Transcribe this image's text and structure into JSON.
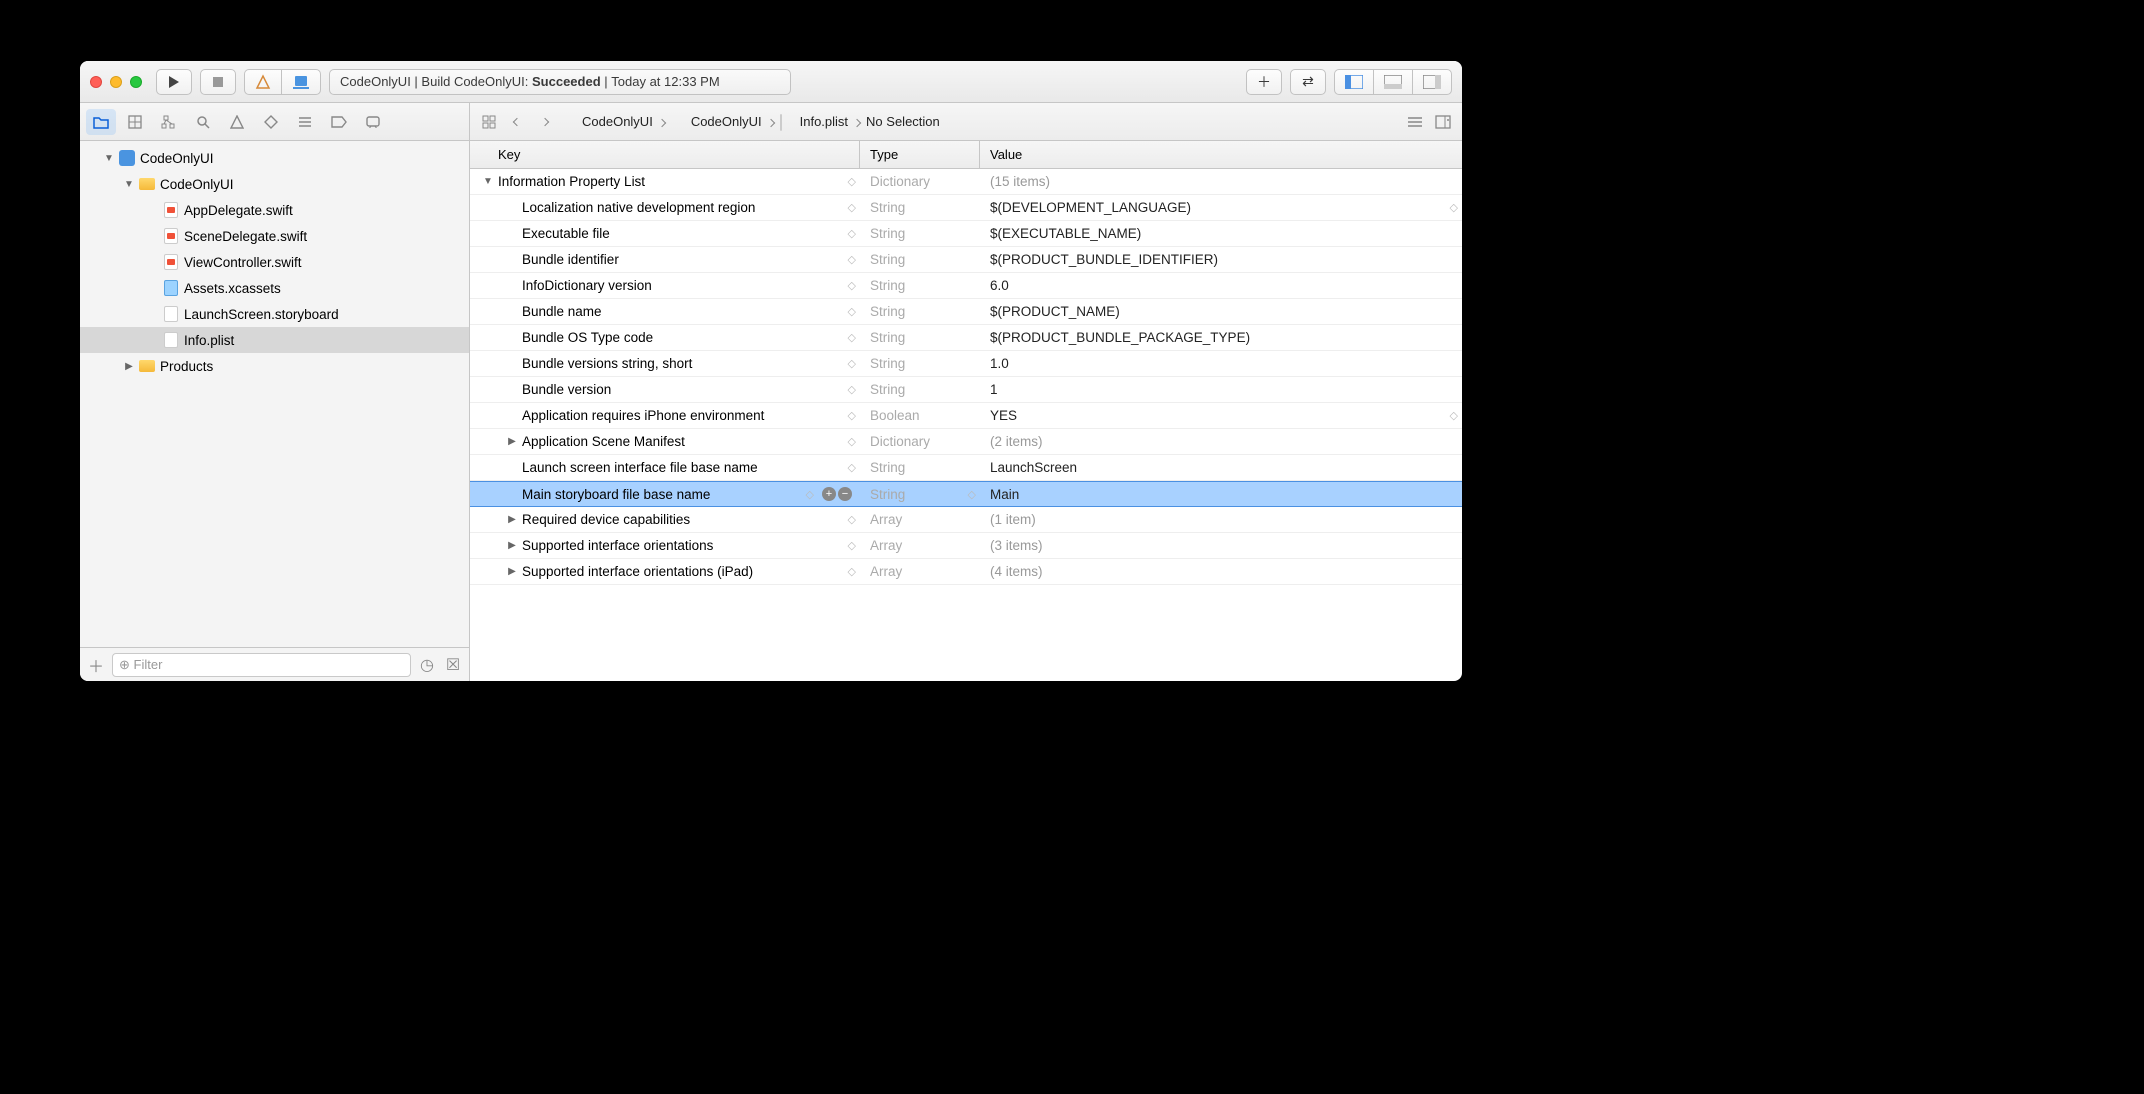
{
  "status": {
    "project": "CodeOnlyUI",
    "build_prefix": "Build CodeOnlyUI:",
    "result": "Succeeded",
    "time": "Today at 12:33 PM"
  },
  "breadcrumb": {
    "items": [
      "CodeOnlyUI",
      "CodeOnlyUI",
      "Info.plist",
      "No Selection"
    ]
  },
  "navigator": {
    "project": "CodeOnlyUI",
    "group": "CodeOnlyUI",
    "files": [
      {
        "name": "AppDelegate.swift",
        "kind": "swift"
      },
      {
        "name": "SceneDelegate.swift",
        "kind": "swift"
      },
      {
        "name": "ViewController.swift",
        "kind": "swift"
      },
      {
        "name": "Assets.xcassets",
        "kind": "asset"
      },
      {
        "name": "LaunchScreen.storyboard",
        "kind": "storyboard"
      },
      {
        "name": "Info.plist",
        "kind": "plist",
        "selected": true
      }
    ],
    "products": "Products"
  },
  "filter_placeholder": "Filter",
  "plist": {
    "columns": {
      "key": "Key",
      "type": "Type",
      "value": "Value"
    },
    "root": {
      "key": "Information Property List",
      "type": "Dictionary",
      "value": "(15 items)"
    },
    "rows": [
      {
        "key": "Localization native development region",
        "type": "String",
        "value": "$(DEVELOPMENT_LANGUAGE)",
        "stepper_right": true
      },
      {
        "key": "Executable file",
        "type": "String",
        "value": "$(EXECUTABLE_NAME)"
      },
      {
        "key": "Bundle identifier",
        "type": "String",
        "value": "$(PRODUCT_BUNDLE_IDENTIFIER)"
      },
      {
        "key": "InfoDictionary version",
        "type": "String",
        "value": "6.0"
      },
      {
        "key": "Bundle name",
        "type": "String",
        "value": "$(PRODUCT_NAME)"
      },
      {
        "key": "Bundle OS Type code",
        "type": "String",
        "value": "$(PRODUCT_BUNDLE_PACKAGE_TYPE)"
      },
      {
        "key": "Bundle versions string, short",
        "type": "String",
        "value": "1.0"
      },
      {
        "key": "Bundle version",
        "type": "String",
        "value": "1"
      },
      {
        "key": "Application requires iPhone environment",
        "type": "Boolean",
        "value": "YES",
        "stepper_right": true
      },
      {
        "key": "Application Scene Manifest",
        "type": "Dictionary",
        "value": "(2 items)",
        "disclosure": "closed",
        "dim": true
      },
      {
        "key": "Launch screen interface file base name",
        "type": "String",
        "value": "LaunchScreen"
      },
      {
        "key": "Main storyboard file base name",
        "type": "String",
        "value": "Main",
        "selected": true,
        "actions": true
      },
      {
        "key": "Required device capabilities",
        "type": "Array",
        "value": "(1 item)",
        "disclosure": "closed",
        "dim": true
      },
      {
        "key": "Supported interface orientations",
        "type": "Array",
        "value": "(3 items)",
        "disclosure": "closed",
        "dim": true
      },
      {
        "key": "Supported interface orientations (iPad)",
        "type": "Array",
        "value": "(4 items)",
        "disclosure": "closed",
        "dim": true
      }
    ]
  }
}
